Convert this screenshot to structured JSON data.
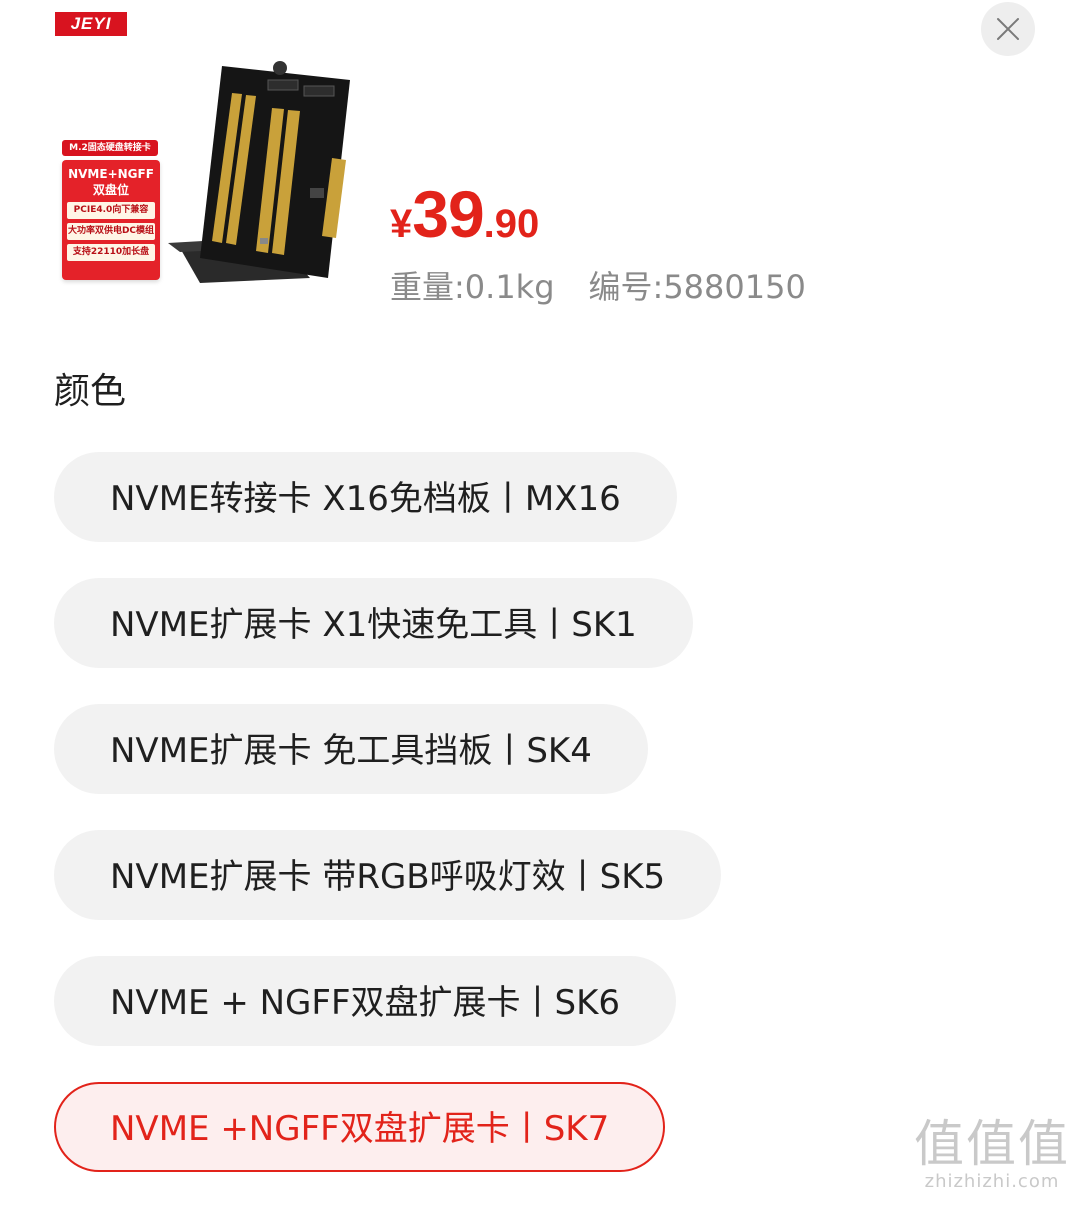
{
  "product": {
    "brand_logo": "JEYI",
    "feature_card": {
      "header": "M.2固态硬盘转接卡",
      "main_line1": "NVME+NGFF",
      "main_line2": "双盘位",
      "lines": [
        "PCIE4.0向下兼容",
        "大功率双供电DC模组",
        "支持22110加长盘"
      ]
    }
  },
  "price": {
    "currency": "¥",
    "integer": "39",
    "decimal": ".90"
  },
  "meta": {
    "weight": "重量:0.1kg",
    "code": "编号:5880150"
  },
  "section": {
    "title": "颜色"
  },
  "options": [
    {
      "label": "NVME转接卡 X16免档板丨MX16",
      "selected": false
    },
    {
      "label": "NVME扩展卡 X1快速免工具丨SK1",
      "selected": false
    },
    {
      "label": "NVME扩展卡 免工具挡板丨SK4",
      "selected": false
    },
    {
      "label": "NVME扩展卡 带RGB呼吸灯效丨SK5",
      "selected": false
    },
    {
      "label": "NVME + NGFF双盘扩展卡丨SK6",
      "selected": false
    },
    {
      "label": "NVME +NGFF双盘扩展卡丨SK7",
      "selected": true
    }
  ],
  "watermark": {
    "main": "值值值",
    "domain": "zhizhizhi.com"
  },
  "colors": {
    "accent": "#e2231a",
    "option_bg": "#f2f2f2",
    "selected_bg": "#fdeeee",
    "meta_text": "#8a8a8a"
  },
  "icons": {
    "close": "close-icon"
  }
}
